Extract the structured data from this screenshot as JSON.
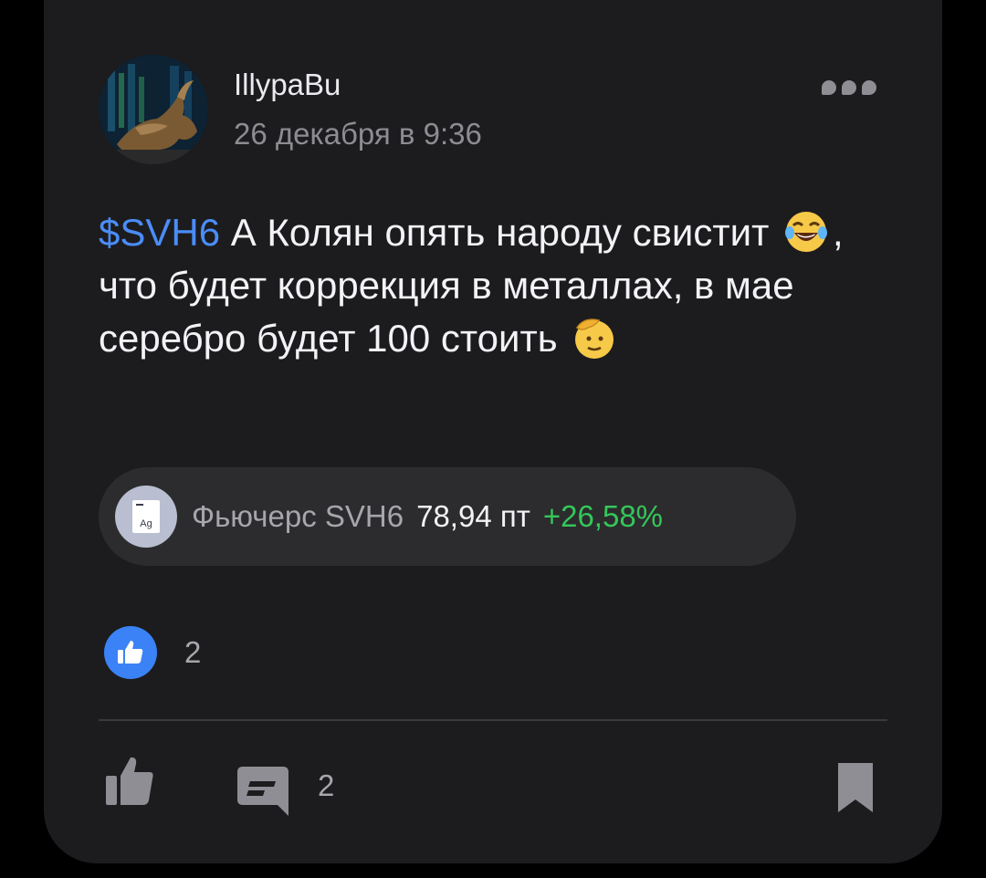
{
  "post": {
    "author": "IllypaBu",
    "date": "26 декабря в 9:36",
    "text": {
      "ticker": "$SVH6",
      "part1": " А Колян опять народу свистит ",
      "emoji1": "joy-crying-emoji",
      "part2": ", что будет коррекция в металлах, в мае серебро будет 100 стоить ",
      "emoji2": "saluting-face-emoji"
    },
    "instrument": {
      "icon_label": "Ag",
      "name": "Фьючерс SVH6",
      "price": "78,94 пт",
      "change": "+26,58%",
      "change_color": "#34c759"
    },
    "reactions": {
      "icon": "thumbs-up-icon",
      "count": "2",
      "accent": "#3b82f6"
    },
    "actions": {
      "like_icon": "thumbs-up-icon",
      "comment_icon": "comment-icon",
      "comment_count": "2",
      "bookmark_icon": "bookmark-icon"
    }
  },
  "colors": {
    "background": "#000000",
    "card": "#1c1c1e",
    "ticker": "#4a8df8"
  }
}
